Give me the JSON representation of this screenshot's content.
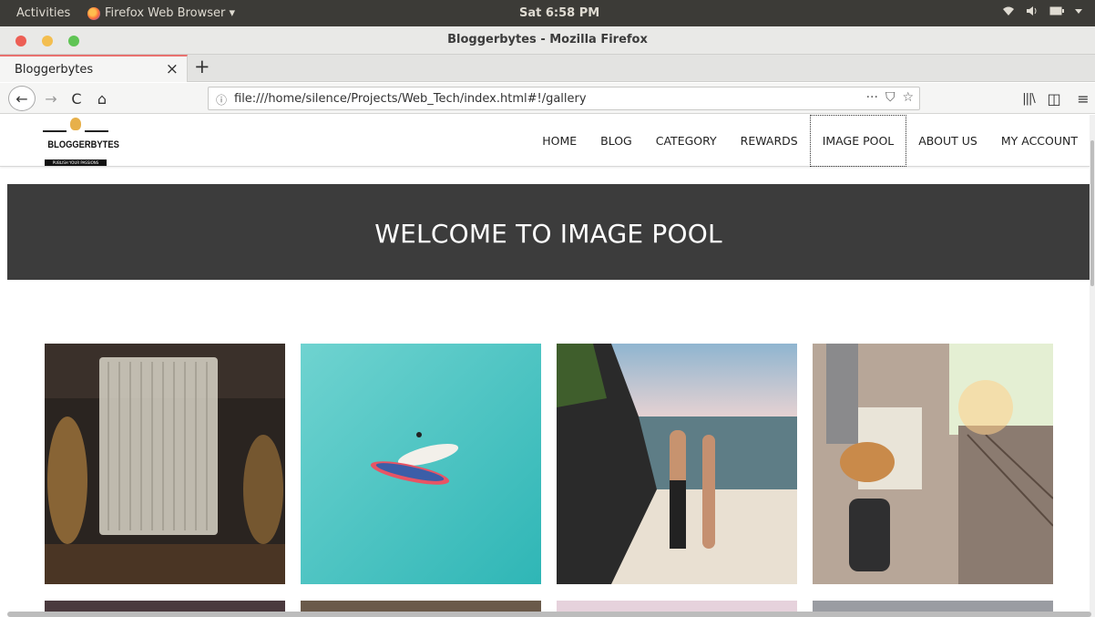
{
  "system_panel": {
    "activities": "Activities",
    "app_name": "Firefox Web Browser ▾",
    "clock": "Sat  6:58 PM",
    "status_icons": [
      "wifi-icon",
      "volume-icon",
      "battery-icon",
      "dropdown-icon"
    ]
  },
  "window": {
    "title": "Bloggerbytes - Mozilla Firefox",
    "controls": {
      "close_color": "#ed5f55",
      "minimize_color": "#f3be4f",
      "maximize_color": "#5fc454"
    }
  },
  "tabs": [
    {
      "label": "Bloggerbytes",
      "close": "×",
      "active": true
    }
  ],
  "new_tab": "+",
  "nav": {
    "back": "←",
    "forward": "→",
    "reload": "C",
    "home": "⌂",
    "info_icon": "ⓘ",
    "url": "file:///home/silence/Projects/Web_Tech/index.html#!/gallery",
    "page_actions": "···",
    "pocket": "⛉",
    "bookmark": "☆",
    "library": "|||\\",
    "sidebar": "◫",
    "menu": "≡"
  },
  "site": {
    "logo_text": "BLOGGERBYTES",
    "logo_tagline": "PUBLISH YOUR PASSIONS",
    "menu": [
      {
        "label": "HOME",
        "active": false
      },
      {
        "label": "BLOG",
        "active": false
      },
      {
        "label": "CATEGORY",
        "active": false
      },
      {
        "label": "REWARDS",
        "active": false
      },
      {
        "label": "IMAGE POOL",
        "active": true
      },
      {
        "label": "ABOUT US",
        "active": false
      },
      {
        "label": "MY ACCOUNT",
        "active": false
      }
    ],
    "hero_title": "WELCOME TO IMAGE POOL",
    "hero_bg": "#3c3c3c"
  },
  "gallery": [
    {
      "name": "hanging-lamps-hall-photo"
    },
    {
      "name": "paddleboards-turquoise-water-photo"
    },
    {
      "name": "couple-on-rocky-beach-photo"
    },
    {
      "name": "traveler-with-map-railway-photo"
    }
  ]
}
